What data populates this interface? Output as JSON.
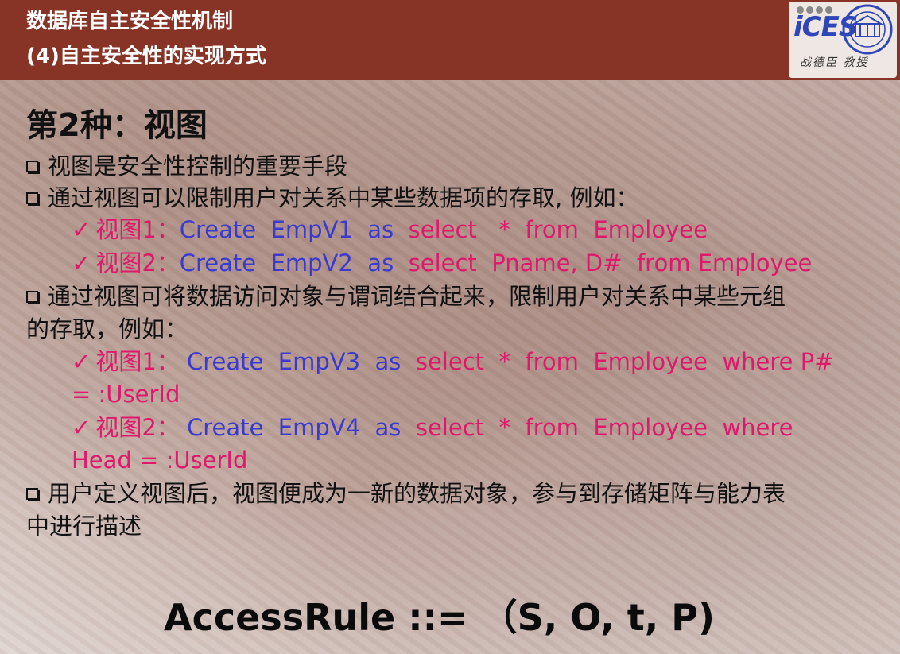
{
  "header": {
    "line1": "数据库自主安全性机制",
    "line2": "(4)自主安全性的实现方式",
    "logo_text": "iCES",
    "logo_author": "战德臣 教授"
  },
  "title": "第2种：视图",
  "bullet1": "视图是安全性控制的重要手段",
  "bullet2": "通过视图可以限制用户对关系中某些数据项的存取, 例如：",
  "ex1": {
    "check": "✓",
    "label": "视图1：",
    "create": "Create",
    "view": "EmpV1",
    "as": "as",
    "select": "select",
    "cols": "*",
    "from": "from",
    "table": "Employee"
  },
  "ex2": {
    "check": "✓",
    "label": "视图2：",
    "create": "Create",
    "view": "EmpV2",
    "as": "as",
    "select": "select",
    "cols": "Pname, D#",
    "from": "from",
    "table": "Employee"
  },
  "bullet3_line1": "通过视图可将数据访问对象与谓词结合起来，限制用户对关系中某些元组",
  "bullet3_line2": "的存取，例如：",
  "ex3": {
    "check": "✓",
    "label": "视图1：",
    "create": "Create",
    "view": "EmpV3",
    "as": "as",
    "select": "select",
    "cols": "*",
    "from": "from",
    "table": "Employee",
    "where": "where",
    "pred1": "P#",
    "pred2": "= :UserId"
  },
  "ex4": {
    "check": "✓",
    "label": "视图2：",
    "create": "Create",
    "view": "EmpV4",
    "as": "as",
    "select": "select",
    "cols": "*",
    "from": "from",
    "table": "Employee",
    "where": "where",
    "pred": "Head = :UserId"
  },
  "bullet4_line1": "用户定义视图后，视图便成为一新的数据对象，参与到存储矩阵与能力表",
  "bullet4_line2": "中进行描述",
  "access_rule": "AccessRule ::= （S, O,  t,  P)",
  "colors": {
    "header": "#873427",
    "keyword_blue": "#3a3ad0",
    "keyword_pink": "#e0186a"
  }
}
